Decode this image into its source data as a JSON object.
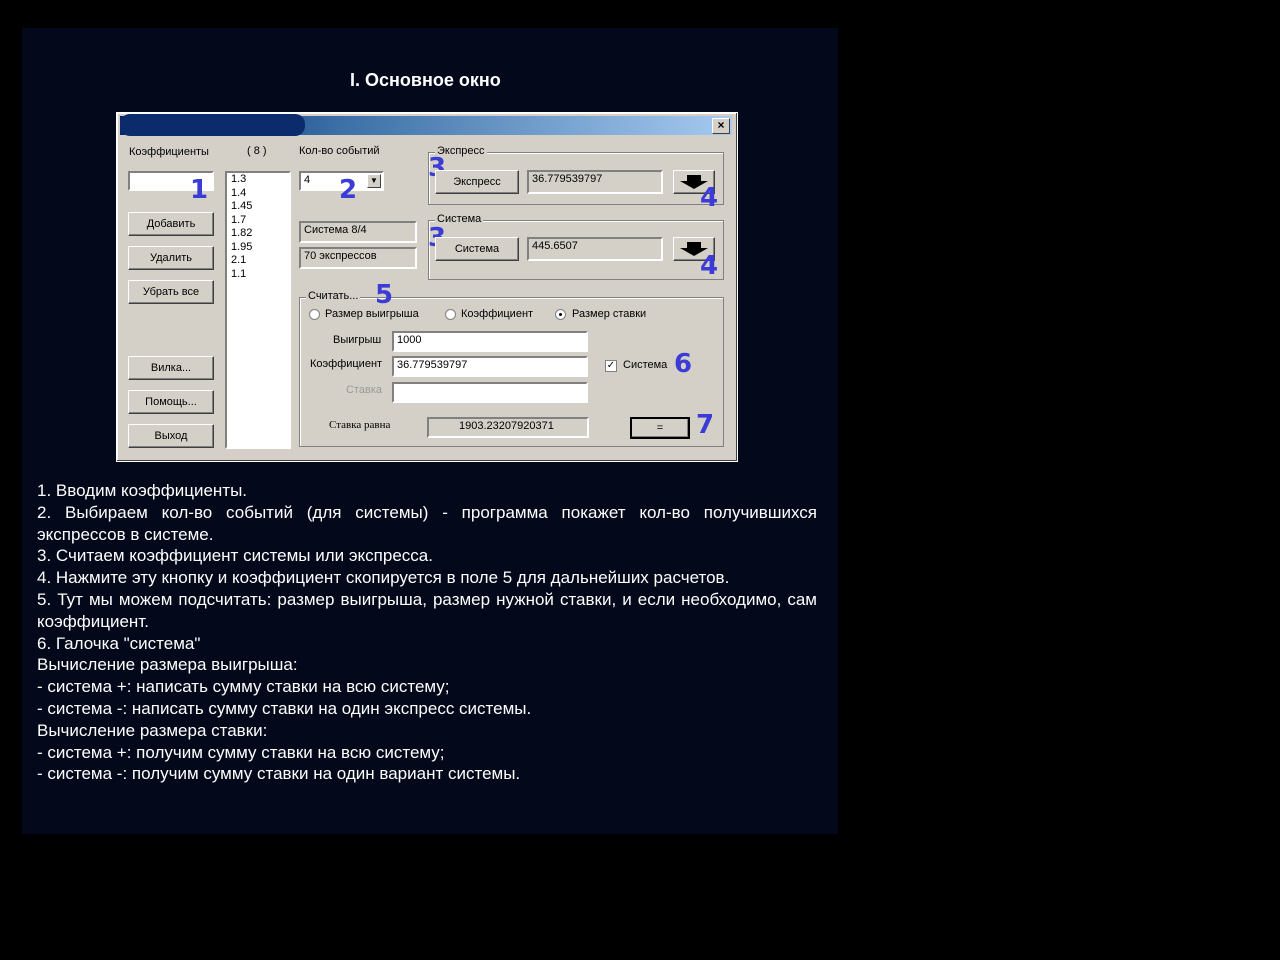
{
  "heading": "I. Основное окно",
  "window": {
    "close_glyph": "×",
    "coef_label": "Коэффициенты",
    "coef_input_value": "",
    "count_label": "( 8 )",
    "coef_list": [
      "1.3",
      "1.4",
      "1.45",
      "1.7",
      "1.82",
      "1.95",
      "2.1",
      "1.1"
    ],
    "buttons": {
      "add": "Добавить",
      "delete": "Удалить",
      "clear_all": "Убрать все",
      "fork": "Вилка...",
      "help": "Помощь...",
      "exit": "Выход"
    },
    "events_label": "Кол-во событий",
    "events_value": "4",
    "system_info": "Система 8/4",
    "express_count": "70 экспрессов",
    "express_group": {
      "title": "Экспресс",
      "button": "Экспресс",
      "value": "36.779539797"
    },
    "system_group": {
      "title": "Система",
      "button": "Система",
      "value": "445.6507"
    },
    "calc_group": {
      "title": "Считать...",
      "radio_win": "Размер выигрыша",
      "radio_coef": "Коэффициент",
      "radio_stake": "Размер ставки",
      "selected": "stake",
      "win_label": "Выигрыш",
      "win_value": "1000",
      "coef_label": "Коэффициент",
      "coef_value": "36.779539797",
      "stake_label": "Ставка",
      "stake_value": "",
      "system_check_label": "Система",
      "system_checked": true,
      "equal_stake_label": "Ставка равна",
      "equal_stake_value": "1903.23207920371",
      "equals_button": "="
    },
    "markers": [
      "1",
      "2",
      "3",
      "3",
      "4",
      "4",
      "5",
      "6",
      "7"
    ]
  },
  "description": [
    "1. Вводим коэффициенты.",
    "2. Выбираем кол-во событий (для системы) - программа покажет кол-во получившихся экспрессов в системе.",
    "3. Считаем коэффициент системы или экспресса.",
    "4. Нажмите эту кнопку и коэффициент скопируется в поле 5 для дальнейших расчетов.",
    "5. Тут мы можем подсчитать: размер выигрыша, размер нужной ставки, и если необходимо, сам коэффициент.",
    "6. Галочка \"система\"",
    "Вычисление размера выигрыша:",
    "- система +: написать сумму ставки на всю систему;",
    "- система -: написать сумму ставки на один экспресс системы.",
    "Вычисление размера ставки:",
    "- система +: получим сумму ставки на всю систему;",
    "- система -: получим сумму ставки на один вариант системы."
  ],
  "colors": {
    "background": "#000000",
    "panel": "#03081a",
    "marker": "#3b3bd6",
    "window_face": "#d4d0c8",
    "titlebar_start": "#0a246a",
    "titlebar_end": "#a6caf0"
  }
}
